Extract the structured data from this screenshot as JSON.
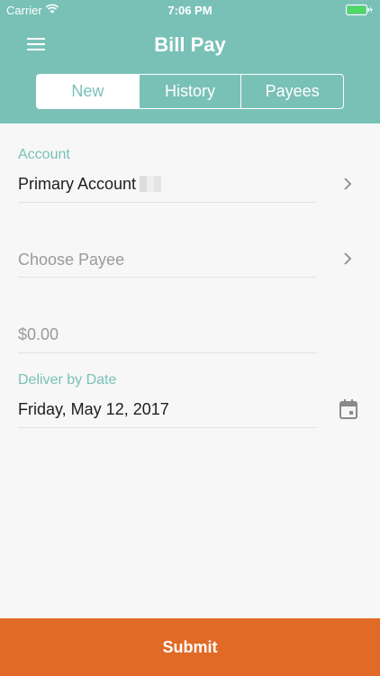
{
  "status": {
    "carrier": "Carrier",
    "time": "7:06 PM"
  },
  "header": {
    "title": "Bill Pay"
  },
  "tabs": [
    {
      "label": "New",
      "active": true
    },
    {
      "label": "History",
      "active": false
    },
    {
      "label": "Payees",
      "active": false
    }
  ],
  "form": {
    "account_label": "Account",
    "account_value": "Primary Account",
    "payee_placeholder": "Choose Payee",
    "amount_placeholder": "$0.00",
    "deliver_label": "Deliver by Date",
    "deliver_value": "Friday, May 12, 2017"
  },
  "submit_label": "Submit",
  "colors": {
    "header": "#79c1b7",
    "accent": "#79c1b7",
    "submit": "#e06a26"
  },
  "icons": [
    "wifi-icon",
    "battery-icon",
    "hamburger-menu-icon",
    "chevron-right-icon",
    "calendar-icon"
  ]
}
